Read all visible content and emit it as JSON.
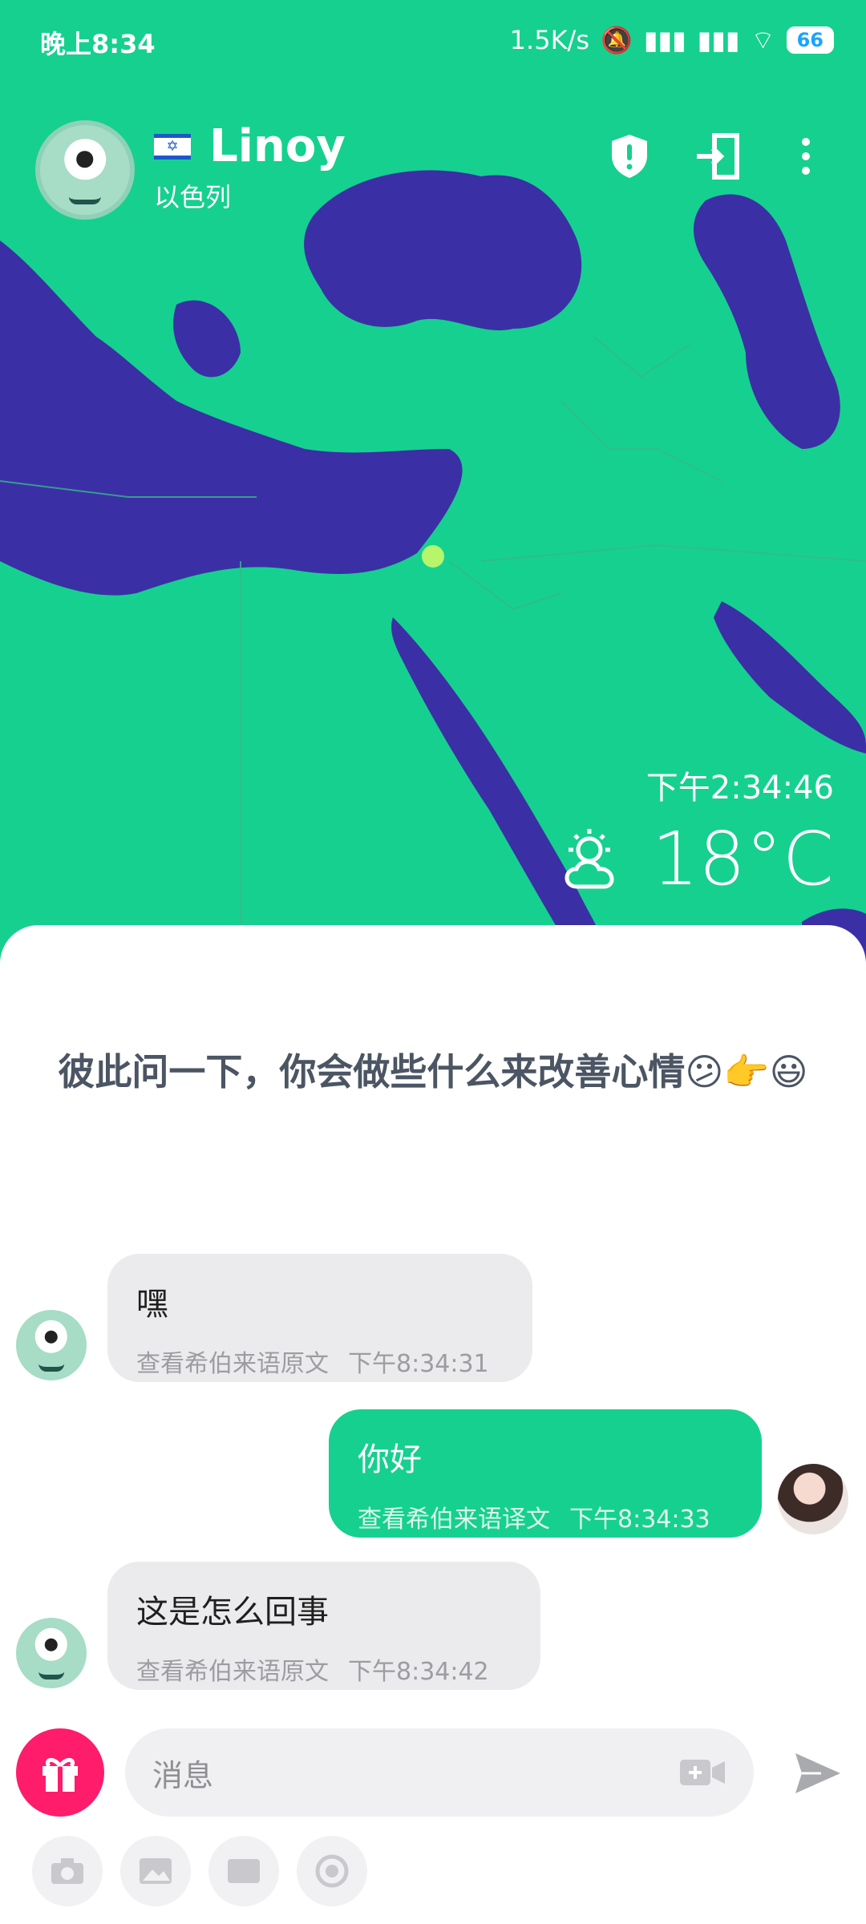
{
  "status_bar": {
    "time": "晚上8:34",
    "speed": "1.5K/s",
    "battery": "66"
  },
  "header": {
    "name": "Linoy",
    "country": "以色列",
    "flag_icon": "israel-flag-icon"
  },
  "map_overlay": {
    "local_time": "下午2:34:46",
    "temperature": "18°C",
    "weather_icon": "partly-cloudy-icon"
  },
  "chat": {
    "prompt": "彼此问一下，你会做些什么来改善心情😕👉😃",
    "messages": [
      {
        "side": "in",
        "text": "嘿",
        "action": "查看希伯来语原文",
        "time": "下午8:34:31"
      },
      {
        "side": "out",
        "text": "你好",
        "action": "查看希伯来语译文",
        "time": "下午8:34:33"
      },
      {
        "side": "in",
        "text": "这是怎么回事",
        "action": "查看希伯来语原文",
        "time": "下午8:34:42"
      }
    ]
  },
  "composer": {
    "placeholder": "消息"
  },
  "colors": {
    "accent": "#16d08f",
    "map_water": "#3b2fa5",
    "gift": "#ff1c6a"
  }
}
